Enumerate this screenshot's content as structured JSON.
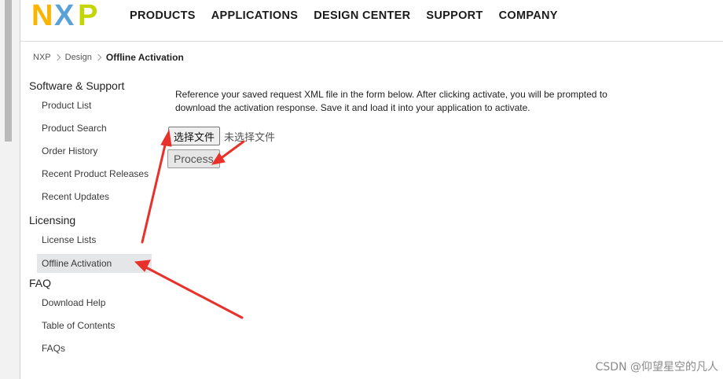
{
  "brand": {
    "logo_text": "NXP",
    "colors": {
      "n": "#f9b500",
      "x": "#5aa1d8",
      "p": "#c4d600"
    }
  },
  "nav": {
    "items": [
      "PRODUCTS",
      "APPLICATIONS",
      "DESIGN CENTER",
      "SUPPORT",
      "COMPANY"
    ]
  },
  "breadcrumb": {
    "items": [
      "NXP",
      "Design"
    ],
    "current": "Offline Activation"
  },
  "sidebar": {
    "sections": [
      {
        "heading": "Software & Support",
        "items": [
          "Product List",
          "Product Search",
          "Order History",
          "Recent Product Releases",
          "Recent Updates"
        ]
      },
      {
        "heading": "Licensing",
        "items": [
          "License Lists",
          "Offline Activation"
        ]
      },
      {
        "heading": "FAQ",
        "items": [
          "Download Help",
          "Table of Contents",
          "FAQs"
        ]
      }
    ],
    "active_item": "Offline Activation"
  },
  "main": {
    "instructions": "Reference your saved request XML file in the form below. After clicking activate, you will be prompted to download the activation response. Save it and load it into your application to activate.",
    "file_button_label": "选择文件",
    "file_status": "未选择文件",
    "process_label": "Process"
  },
  "annotation": {
    "arrow_color": "#e8312a"
  },
  "watermark": "CSDN @仰望星空的凡人"
}
